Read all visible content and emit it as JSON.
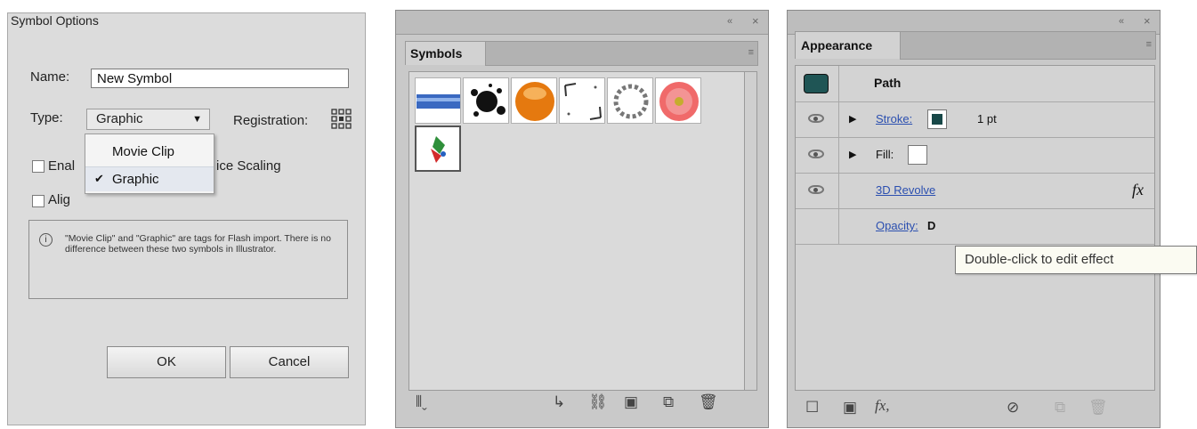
{
  "symbol_options_dialog": {
    "title": "Symbol Options",
    "name_label": "Name:",
    "name_value": "New Symbol",
    "type_label": "Type:",
    "type_value": "Graphic",
    "registration_label": "Registration:",
    "type_options": [
      "Movie Clip",
      "Graphic"
    ],
    "enable_guides_label_visible_start": "Enal",
    "enable_guides_label_visible_end": "ice Scaling",
    "align_label_visible": "Alig",
    "info_icon": "info-icon",
    "info_text": "\"Movie Clip\" and \"Graphic\" are tags for Flash import. There is no difference between these two symbols in Illustrator.",
    "ok_label": "OK",
    "cancel_label": "Cancel"
  },
  "symbols_panel": {
    "collapse_label": "«",
    "close_label": "×",
    "tab_label": "Symbols",
    "menu_label": "≡",
    "swatches": [
      "blue-bar",
      "ink-splat",
      "orange-sphere",
      "grunge-frame",
      "dot-ring",
      "flower",
      "ribbon"
    ],
    "bottom_icons": [
      "symbol-libraries-icon",
      "place-symbol-icon",
      "break-link-icon",
      "symbol-options-icon",
      "new-symbol-icon",
      "delete-icon"
    ]
  },
  "appearance_panel": {
    "collapse_label": "«",
    "close_label": "×",
    "tab_label": "Appearance",
    "menu_label": "≡",
    "header_label": "Path",
    "stroke_label": "Stroke:",
    "stroke_value": "1 pt",
    "fill_label": "Fill:",
    "effect_label": "3D Revolve",
    "fx_label": "fx",
    "opacity_label": "Opacity:",
    "opacity_value_visible": "D",
    "tooltip": "Double-click to edit effect",
    "bottom_fx_label": "fx,",
    "colors": {
      "path_color": "#1f5555",
      "stroke_color": "#184848"
    }
  }
}
